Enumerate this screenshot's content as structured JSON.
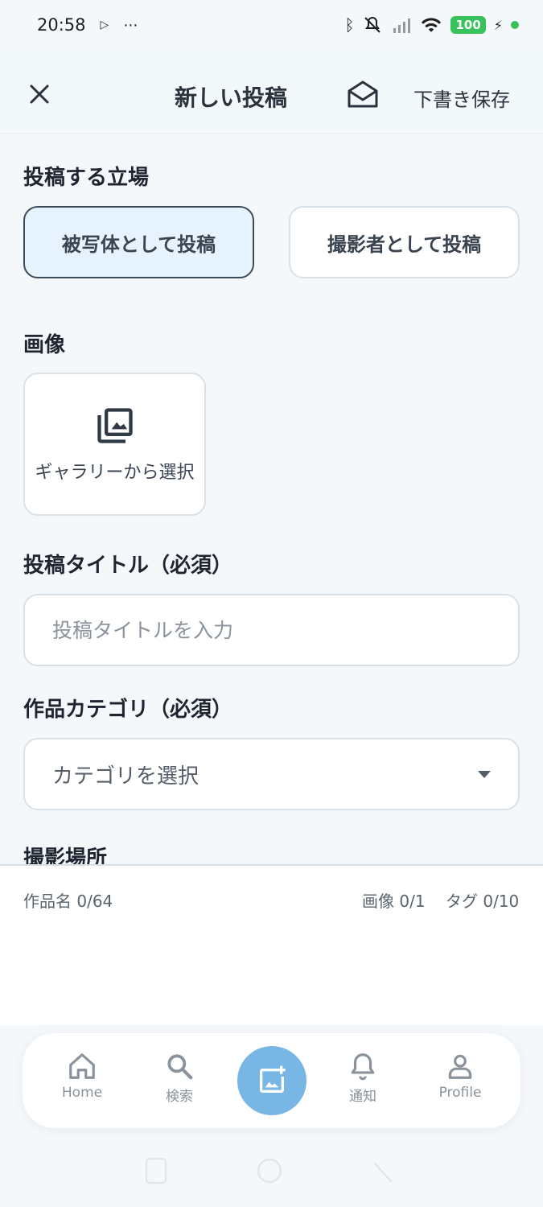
{
  "status": {
    "time": "20:58",
    "battery": "100"
  },
  "header": {
    "title": "新しい投稿",
    "draft_save": "下書き保存"
  },
  "position": {
    "label": "投稿する立場",
    "options": [
      "被写体として投稿",
      "撮影者として投稿"
    ],
    "selected": "被写体として投稿"
  },
  "image": {
    "label": "画像",
    "gallery_button": "ギャラリーから選択"
  },
  "title_field": {
    "label": "投稿タイトル（必須）",
    "placeholder": "投稿タイトルを入力",
    "value": ""
  },
  "category": {
    "label": "作品カテゴリ（必須）",
    "selected": "カテゴリを選択"
  },
  "location": {
    "label": "撮影場所"
  },
  "counters": {
    "work_name": "作品名 0/64",
    "images": "画像 0/1",
    "tags": "タグ 0/10"
  },
  "nav": {
    "home": "Home",
    "search": "検索",
    "notify": "通知",
    "profile": "Profile"
  },
  "colors": {
    "accent": "#78b6e6",
    "selected_bg": "#e7f3fc",
    "battery": "#37c25b"
  }
}
